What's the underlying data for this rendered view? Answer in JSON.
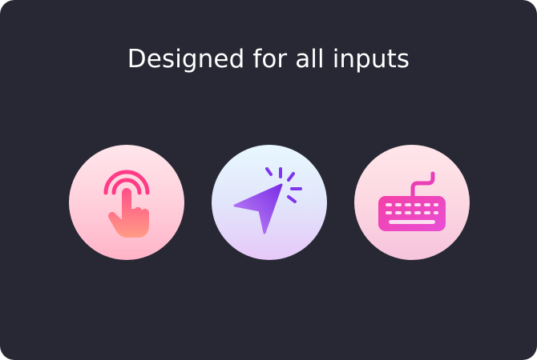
{
  "heading": "Designed for all inputs",
  "inputs": [
    {
      "icon": "touch-icon"
    },
    {
      "icon": "pointer-icon"
    },
    {
      "icon": "keyboard-icon"
    }
  ],
  "colors": {
    "background": "#272833",
    "heading": "#ffffff",
    "touch_accent": "#ff3b7f",
    "pointer_accent": "#8a3cf0",
    "keyboard_accent": "#ee3fb8"
  }
}
